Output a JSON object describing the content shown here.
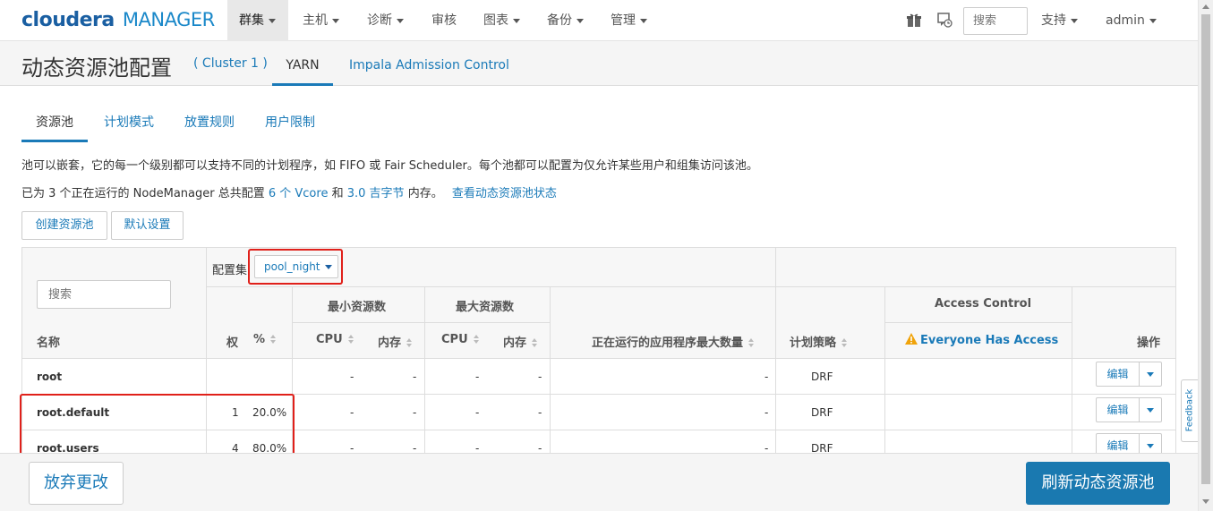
{
  "brand": {
    "name": "cloudera",
    "product": "MANAGER"
  },
  "nav": {
    "items": [
      "群集",
      "主机",
      "诊断",
      "审核",
      "图表",
      "备份",
      "管理"
    ],
    "search_placeholder": "搜索",
    "support": "支持",
    "user": "admin"
  },
  "page": {
    "title": "动态资源池配置",
    "cluster": "( Cluster 1 )",
    "tabs": [
      "YARN",
      "Impala Admission Control"
    ]
  },
  "subtabs": [
    "资源池",
    "计划模式",
    "放置规则",
    "用户限制"
  ],
  "description": {
    "line1": "池可以嵌套，它的每一个级别都可以支持不同的计划程序，如 FIFO 或 Fair Scheduler。每个池都可以配置为仅允许某些用户和组集访问该池。",
    "line2_prefix": "已为 3 个正在运行的 NodeManager 总共配置",
    "vcores": "6 个 Vcore",
    "and": "和",
    "memory": "3.0 吉字节",
    "line2_suffix": "内存。",
    "status_link": "查看动态资源池状态"
  },
  "buttons": {
    "create": "创建资源池",
    "defaults": "默认设置"
  },
  "table": {
    "search_placeholder": "搜索",
    "config_set_label": "配置集",
    "config_set_value": "pool_night",
    "headers": {
      "name": "名称",
      "weight": "权",
      "percent": "%",
      "min_resources": "最小资源数",
      "max_resources": "最大资源数",
      "cpu": "CPU",
      "memory": "内存",
      "max_running_apps": "正在运行的应用程序最大数量",
      "scheduling_policy": "计划策略",
      "access_control": "Access Control",
      "everyone_access": "Everyone Has Access",
      "actions": "操作"
    },
    "rows": [
      {
        "name": "root",
        "weight": "",
        "percent": "",
        "min_cpu": "-",
        "min_mem": "-",
        "max_cpu": "-",
        "max_mem": "-",
        "max_apps": "-",
        "policy": "DRF",
        "edit": "编辑"
      },
      {
        "name": "root.default",
        "weight": "1",
        "percent": "20.0%",
        "min_cpu": "-",
        "min_mem": "-",
        "max_cpu": "-",
        "max_mem": "-",
        "max_apps": "-",
        "policy": "DRF",
        "edit": "编辑"
      },
      {
        "name": "root.users",
        "weight": "4",
        "percent": "80.0%",
        "min_cpu": "-",
        "min_mem": "-",
        "max_cpu": "-",
        "max_mem": "-",
        "max_apps": "-",
        "policy": "DRF",
        "edit": "编辑"
      }
    ]
  },
  "footer": {
    "discard": "放弃更改",
    "refresh": "刷新动态资源池"
  },
  "feedback": "Feedback",
  "colors": {
    "accent": "#1a7ab8",
    "highlight": "#e0201a",
    "primary_button": "#1a79b0",
    "warning": "#f0a30a"
  }
}
